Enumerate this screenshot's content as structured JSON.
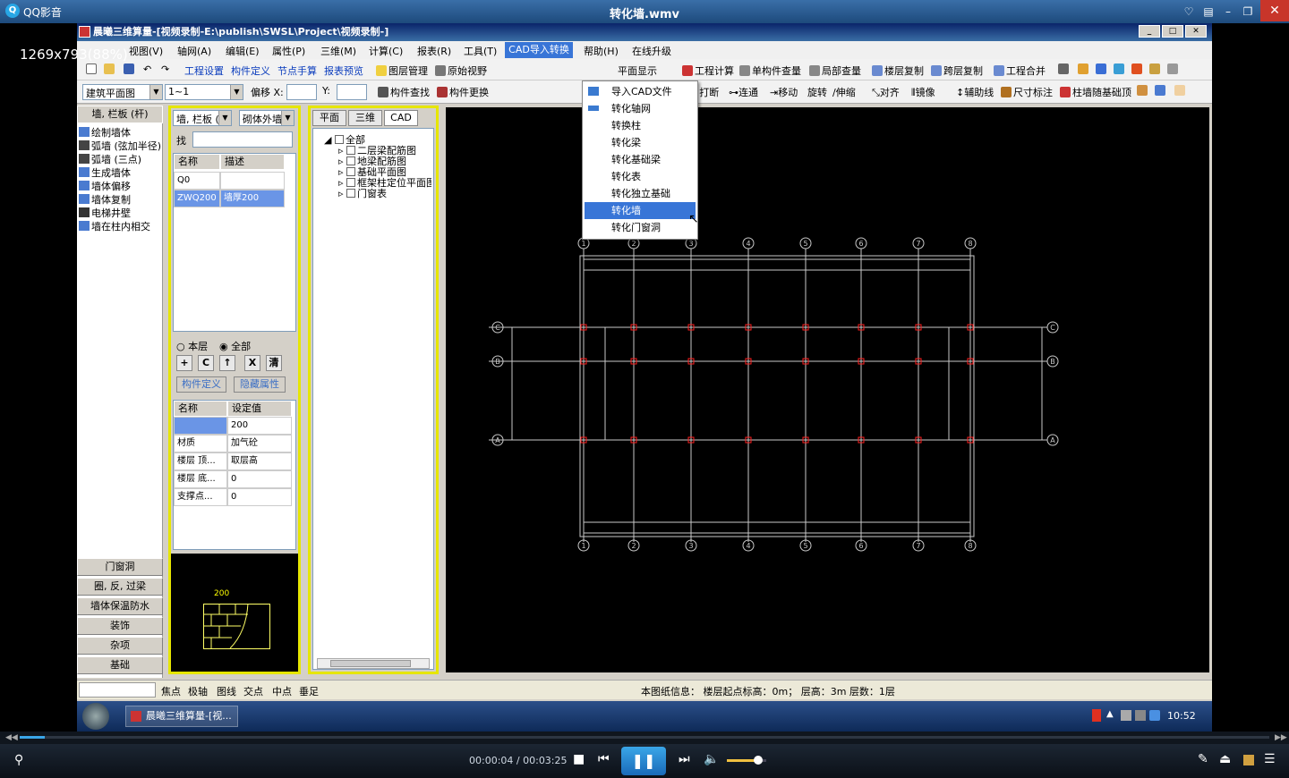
{
  "player": {
    "app_name": "QQ影音",
    "file_title": "转化墙.wmv",
    "overlay_size": "1269x793(88%)",
    "time_current": "00:00:04",
    "time_sep": " / ",
    "time_total": "00:03:25",
    "progress": 0.02,
    "volume": 0.8
  },
  "app": {
    "title": "晨曦三维算量-[视频录制-E:\\publish\\SWSL\\Project\\视频录制-]",
    "menus": [
      "视图(V)",
      "轴网(A)",
      "编辑(E)",
      "属性(P)",
      "三维(M)",
      "计算(C)",
      "报表(R)",
      "工具(T)",
      "CAD导入转换",
      "帮助(H)",
      "在线升级"
    ],
    "toolbar1": {
      "blue": [
        "工程设置",
        "构件定义",
        "节点手算",
        "报表预览"
      ],
      "items": [
        "图层管理",
        "原始视野",
        "平面显示",
        "工程计算",
        "单构件查量",
        "局部查量",
        "楼层复制",
        "跨层复制",
        "工程合并"
      ]
    },
    "toolbar2": {
      "combo_plan": "建筑平面图",
      "combo_floor": "1~1",
      "offset_label": "偏移 X:",
      "y_label": "Y:",
      "items_left": [
        "构件查找",
        "构件更换"
      ],
      "items_right": [
        "复制",
        "删除",
        "打断",
        "连通",
        "移动",
        "旋转",
        "伸缩",
        "对齐",
        "镜像",
        "辅助线",
        "尺寸标注",
        "柱墙随基础顶"
      ]
    },
    "left_panel": {
      "header": "墙, 栏板 (杆)",
      "items": [
        "绘制墙体",
        "弧墙 (弦加半径)",
        "弧墙 (三点)",
        "生成墙体",
        "墙体偏移",
        "墙体复制",
        "电梯井壁",
        "墙在柱内相交"
      ],
      "bottom_buttons": [
        "门窗洞",
        "圈, 反, 过梁",
        "墙体保温防水",
        "装饰",
        "杂项",
        "基础"
      ]
    },
    "comp_panel": {
      "combo_type": "墙, 栏板 (f",
      "combo_wall": "砌体外墙",
      "find_label": "找",
      "list_headers": [
        "名称",
        "描述"
      ],
      "list_rows": [
        [
          "Q0",
          ""
        ],
        [
          "ZWQ200",
          "墙厚200"
        ]
      ],
      "radio_floor": "本层",
      "radio_all": "全部",
      "tool_buttons": [
        "+",
        "C",
        "↑",
        "X",
        "清"
      ],
      "define_button": "构件定义",
      "hide_button": "隐藏属性",
      "prop_headers": [
        "名称",
        "设定值"
      ],
      "props": [
        [
          "",
          "200"
        ],
        [
          "材质",
          "加气砼"
        ],
        [
          "楼层 顶...",
          "取层高"
        ],
        [
          "楼层 底...",
          "0"
        ],
        [
          "支撑点...",
          "0"
        ]
      ],
      "preview_value": "200"
    },
    "tree_panel": {
      "tabs": [
        "平面",
        "三维",
        "CAD"
      ],
      "root": "全部",
      "items": [
        "二层梁配筋图",
        "地梁配筋图",
        "基础平面图",
        "框架柱定位平面图",
        "门窗表"
      ]
    },
    "cad_menu": {
      "items": [
        "导入CAD文件",
        "转化轴网",
        "转换柱",
        "转化梁",
        "转化基础梁",
        "转化表",
        "转化独立基础",
        "转化墙",
        "转化门窗洞"
      ],
      "selected_index": 7
    },
    "drawing": {
      "axis_numbers": [
        "1",
        "2",
        "3",
        "4",
        "5",
        "6",
        "7",
        "8"
      ],
      "axis_letters": [
        "C",
        "B",
        "A"
      ]
    },
    "statusbar": {
      "snaps": [
        "焦点",
        "极轴",
        "图线",
        "交点",
        "中点",
        "垂足"
      ],
      "info": "本图纸信息： 楼层起点标高：0m； 层高：3m 层数：1层"
    }
  },
  "taskbar": {
    "task_label": "晨曦三维算量-[视...",
    "clock": "10:52"
  }
}
